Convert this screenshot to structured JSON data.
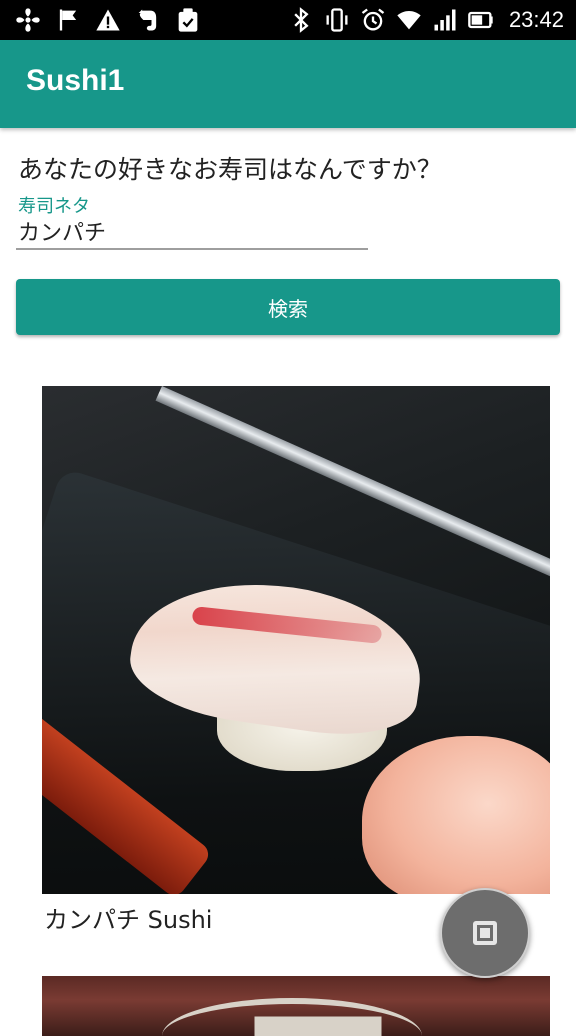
{
  "status_bar": {
    "time": "23:42",
    "left_icons": [
      "fan-icon",
      "flag-icon",
      "warning-icon",
      "evernote-icon",
      "clipboard-check-icon"
    ],
    "right_icons": [
      "bluetooth-icon",
      "vibrate-icon",
      "alarm-icon",
      "wifi-icon",
      "signal-icon",
      "battery-icon"
    ]
  },
  "app_bar": {
    "title": "Sushi1"
  },
  "form": {
    "question": "あなたの好きなお寿司はなんですか？",
    "field_label": "寿司ネタ",
    "field_value": "カンパチ",
    "search_label": "検索"
  },
  "results": [
    {
      "caption": "カンパチ Sushi"
    },
    {
      "caption": ""
    }
  ],
  "fab": {
    "icon": "stop-icon"
  },
  "colors": {
    "primary": "#17978a",
    "status_bar": "#000000",
    "background": "#ffffff"
  }
}
